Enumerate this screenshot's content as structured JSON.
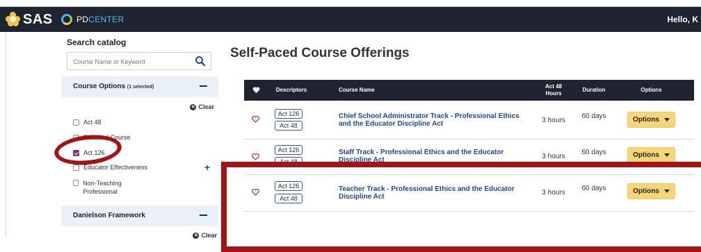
{
  "header": {
    "brand": "SAS",
    "product_prefix": "PD",
    "product_suffix": "CENTER",
    "greeting": "Hello, K",
    "bg_color": "#1f2530"
  },
  "sidebar": {
    "search_label": "Search catalog",
    "search_placeholder": "Course Name or Keyword",
    "course_options_title": "Course Options",
    "course_options_selected": "(1 selected)",
    "clear_label": "Clear",
    "filters": [
      {
        "label": "Act 48",
        "checked": false
      },
      {
        "label": "Featured Course",
        "checked": false
      },
      {
        "label": "Act 126",
        "checked": true
      },
      {
        "label": "Educator Effectiveness",
        "checked": false
      },
      {
        "label": "Non-Teaching Professional",
        "checked": false
      }
    ],
    "danielson_title": "Danielson Framework",
    "clear2_label": "Clear"
  },
  "main": {
    "title": "Self-Paced Course Offerings",
    "columns": {
      "descriptors": "Descriptors",
      "course_name": "Course Name",
      "act48_hours": "Act 48 Hours",
      "duration": "Duration",
      "options": "Options"
    },
    "rows": [
      {
        "tags": [
          "Act 126",
          "Act 48"
        ],
        "course_name": "Chief School Administrator Track - Professional Ethics and the Educator Discipline Act",
        "hours": "3 hours",
        "duration": "60 days",
        "button": "Options"
      },
      {
        "tags": [
          "Act 126",
          "Act 48"
        ],
        "course_name": "Staff Track - Professional Ethics and the Educator Discipline Act",
        "hours": "3 hours",
        "duration": "60 days",
        "button": "Options"
      },
      {
        "tags": [
          "Act 126",
          "Act 48"
        ],
        "course_name": "Teacher Track - Professional Ethics and the Educator Discipline Act",
        "hours": "3 hours",
        "duration": "60 days",
        "button": "Options"
      }
    ]
  },
  "colors": {
    "accent_yellow": "#f5d77a",
    "link_blue": "#1f4597",
    "annotation_red": "#a41316",
    "checkbox_purple": "#7a2e8c"
  }
}
